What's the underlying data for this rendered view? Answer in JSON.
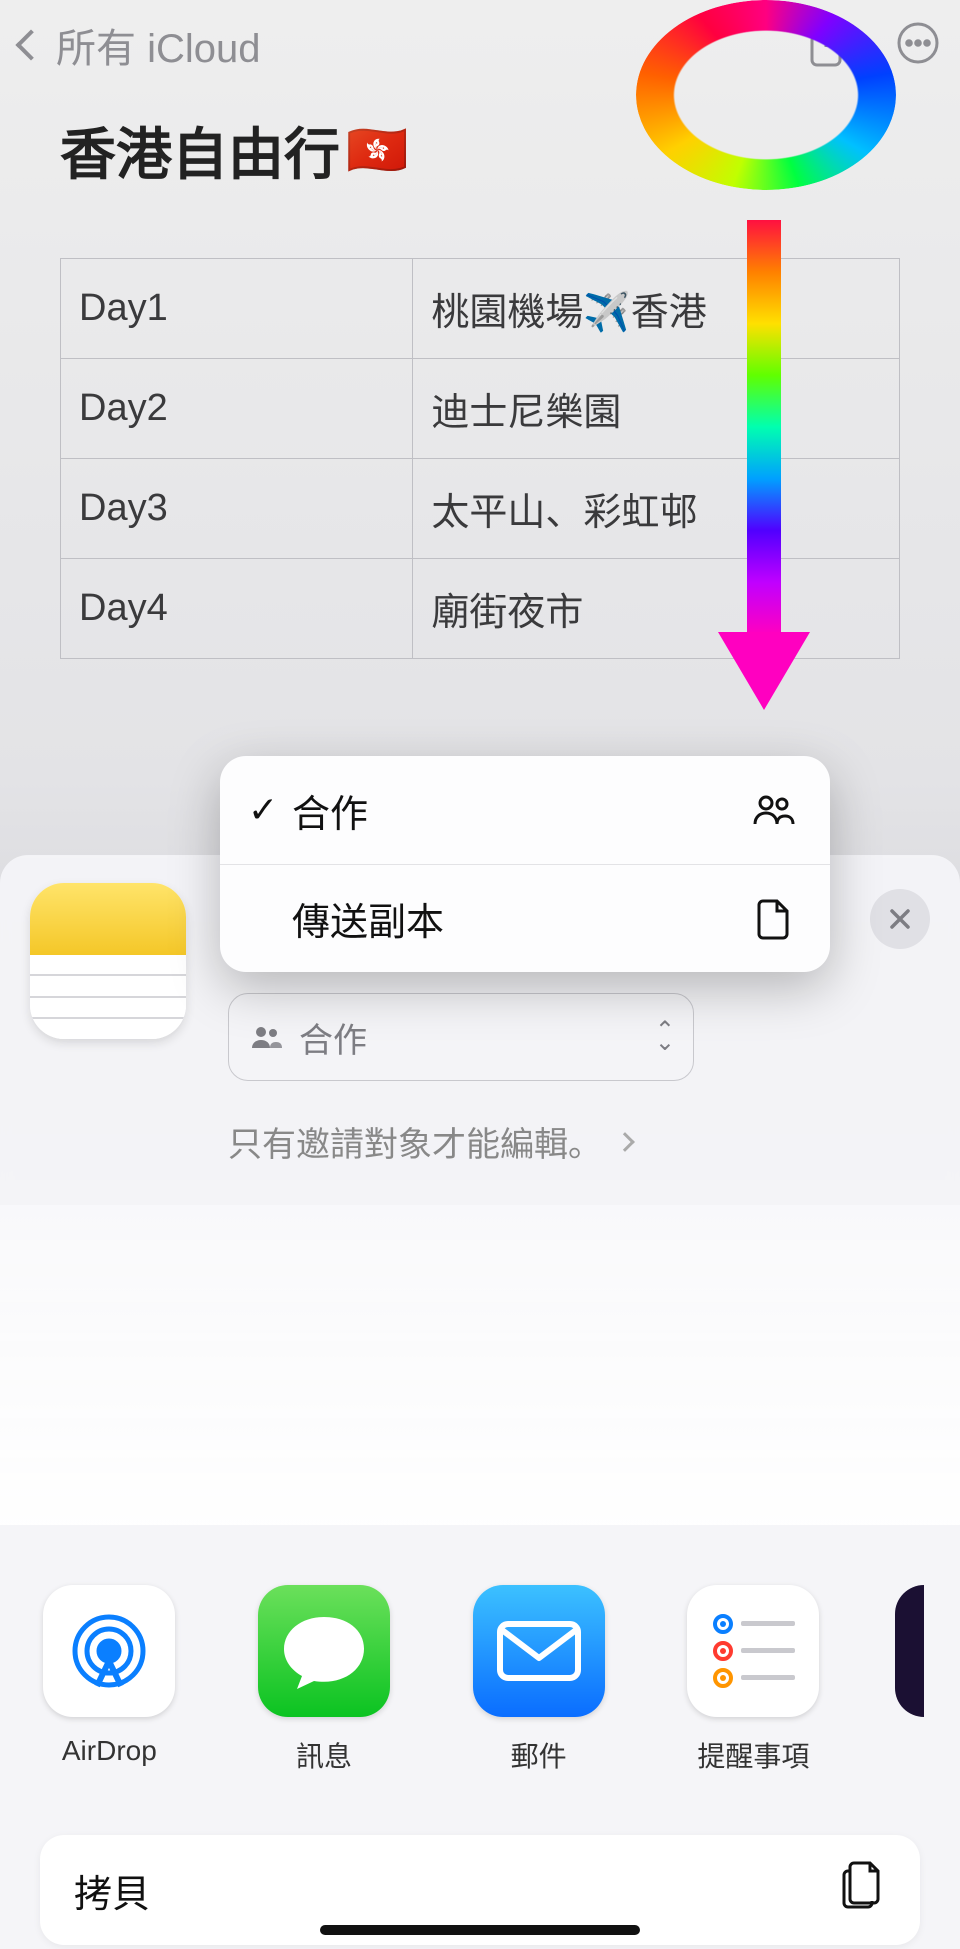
{
  "nav": {
    "back_label": "所有 iCloud"
  },
  "note": {
    "title": "香港自由行",
    "flag": "🇭🇰",
    "table": [
      {
        "day": "Day1",
        "plan": "桃園機場✈️香港"
      },
      {
        "day": "Day2",
        "plan": "迪士尼樂園"
      },
      {
        "day": "Day3",
        "plan": "太平山、彩虹邨"
      },
      {
        "day": "Day4",
        "plan": "廟街夜市"
      }
    ]
  },
  "popover": {
    "collaborate_label": "合作",
    "send_copy_label": "傳送副本"
  },
  "sheet": {
    "mode_label": "合作",
    "permission_text": "只有邀請對象才能編輯。",
    "apps": {
      "airdrop": "AirDrop",
      "messages": "訊息",
      "mail": "郵件",
      "reminders": "提醒事項"
    },
    "actions": {
      "copy": "拷貝"
    }
  }
}
